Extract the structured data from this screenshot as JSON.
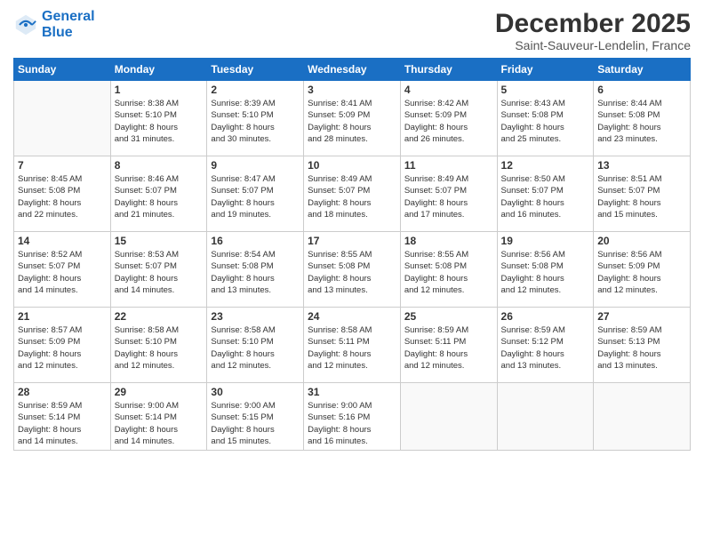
{
  "logo": {
    "line1": "General",
    "line2": "Blue"
  },
  "title": "December 2025",
  "location": "Saint-Sauveur-Lendelin, France",
  "days_header": [
    "Sunday",
    "Monday",
    "Tuesday",
    "Wednesday",
    "Thursday",
    "Friday",
    "Saturday"
  ],
  "weeks": [
    [
      {
        "day": "",
        "info": ""
      },
      {
        "day": "1",
        "info": "Sunrise: 8:38 AM\nSunset: 5:10 PM\nDaylight: 8 hours\nand 31 minutes."
      },
      {
        "day": "2",
        "info": "Sunrise: 8:39 AM\nSunset: 5:10 PM\nDaylight: 8 hours\nand 30 minutes."
      },
      {
        "day": "3",
        "info": "Sunrise: 8:41 AM\nSunset: 5:09 PM\nDaylight: 8 hours\nand 28 minutes."
      },
      {
        "day": "4",
        "info": "Sunrise: 8:42 AM\nSunset: 5:09 PM\nDaylight: 8 hours\nand 26 minutes."
      },
      {
        "day": "5",
        "info": "Sunrise: 8:43 AM\nSunset: 5:08 PM\nDaylight: 8 hours\nand 25 minutes."
      },
      {
        "day": "6",
        "info": "Sunrise: 8:44 AM\nSunset: 5:08 PM\nDaylight: 8 hours\nand 23 minutes."
      }
    ],
    [
      {
        "day": "7",
        "info": "Sunrise: 8:45 AM\nSunset: 5:08 PM\nDaylight: 8 hours\nand 22 minutes."
      },
      {
        "day": "8",
        "info": "Sunrise: 8:46 AM\nSunset: 5:07 PM\nDaylight: 8 hours\nand 21 minutes."
      },
      {
        "day": "9",
        "info": "Sunrise: 8:47 AM\nSunset: 5:07 PM\nDaylight: 8 hours\nand 19 minutes."
      },
      {
        "day": "10",
        "info": "Sunrise: 8:49 AM\nSunset: 5:07 PM\nDaylight: 8 hours\nand 18 minutes."
      },
      {
        "day": "11",
        "info": "Sunrise: 8:49 AM\nSunset: 5:07 PM\nDaylight: 8 hours\nand 17 minutes."
      },
      {
        "day": "12",
        "info": "Sunrise: 8:50 AM\nSunset: 5:07 PM\nDaylight: 8 hours\nand 16 minutes."
      },
      {
        "day": "13",
        "info": "Sunrise: 8:51 AM\nSunset: 5:07 PM\nDaylight: 8 hours\nand 15 minutes."
      }
    ],
    [
      {
        "day": "14",
        "info": "Sunrise: 8:52 AM\nSunset: 5:07 PM\nDaylight: 8 hours\nand 14 minutes."
      },
      {
        "day": "15",
        "info": "Sunrise: 8:53 AM\nSunset: 5:07 PM\nDaylight: 8 hours\nand 14 minutes."
      },
      {
        "day": "16",
        "info": "Sunrise: 8:54 AM\nSunset: 5:08 PM\nDaylight: 8 hours\nand 13 minutes."
      },
      {
        "day": "17",
        "info": "Sunrise: 8:55 AM\nSunset: 5:08 PM\nDaylight: 8 hours\nand 13 minutes."
      },
      {
        "day": "18",
        "info": "Sunrise: 8:55 AM\nSunset: 5:08 PM\nDaylight: 8 hours\nand 12 minutes."
      },
      {
        "day": "19",
        "info": "Sunrise: 8:56 AM\nSunset: 5:08 PM\nDaylight: 8 hours\nand 12 minutes."
      },
      {
        "day": "20",
        "info": "Sunrise: 8:56 AM\nSunset: 5:09 PM\nDaylight: 8 hours\nand 12 minutes."
      }
    ],
    [
      {
        "day": "21",
        "info": "Sunrise: 8:57 AM\nSunset: 5:09 PM\nDaylight: 8 hours\nand 12 minutes."
      },
      {
        "day": "22",
        "info": "Sunrise: 8:58 AM\nSunset: 5:10 PM\nDaylight: 8 hours\nand 12 minutes."
      },
      {
        "day": "23",
        "info": "Sunrise: 8:58 AM\nSunset: 5:10 PM\nDaylight: 8 hours\nand 12 minutes."
      },
      {
        "day": "24",
        "info": "Sunrise: 8:58 AM\nSunset: 5:11 PM\nDaylight: 8 hours\nand 12 minutes."
      },
      {
        "day": "25",
        "info": "Sunrise: 8:59 AM\nSunset: 5:11 PM\nDaylight: 8 hours\nand 12 minutes."
      },
      {
        "day": "26",
        "info": "Sunrise: 8:59 AM\nSunset: 5:12 PM\nDaylight: 8 hours\nand 13 minutes."
      },
      {
        "day": "27",
        "info": "Sunrise: 8:59 AM\nSunset: 5:13 PM\nDaylight: 8 hours\nand 13 minutes."
      }
    ],
    [
      {
        "day": "28",
        "info": "Sunrise: 8:59 AM\nSunset: 5:14 PM\nDaylight: 8 hours\nand 14 minutes."
      },
      {
        "day": "29",
        "info": "Sunrise: 9:00 AM\nSunset: 5:14 PM\nDaylight: 8 hours\nand 14 minutes."
      },
      {
        "day": "30",
        "info": "Sunrise: 9:00 AM\nSunset: 5:15 PM\nDaylight: 8 hours\nand 15 minutes."
      },
      {
        "day": "31",
        "info": "Sunrise: 9:00 AM\nSunset: 5:16 PM\nDaylight: 8 hours\nand 16 minutes."
      },
      {
        "day": "",
        "info": ""
      },
      {
        "day": "",
        "info": ""
      },
      {
        "day": "",
        "info": ""
      }
    ]
  ]
}
